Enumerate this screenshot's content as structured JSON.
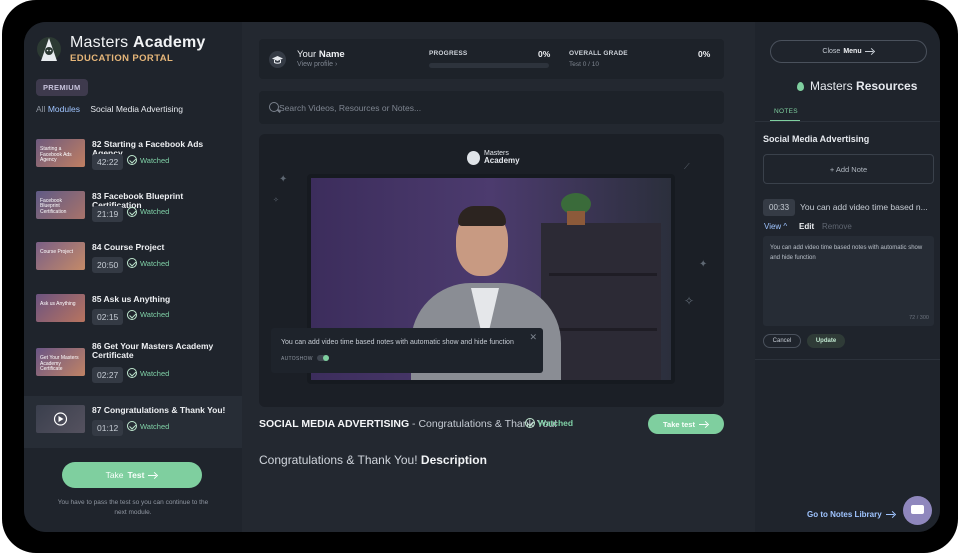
{
  "brand": {
    "title_light": "Masters",
    "title_bold": "Academy",
    "subtitle": "EDUCATION PORTAL",
    "badge": "PREMIUM"
  },
  "breadcrumb": {
    "all": "All",
    "modules": "Modules",
    "current": "Social Media Advertising"
  },
  "lessons": [
    {
      "thumb": "Starting a Facebook Ads Agency",
      "title": "82 Starting a Facebook Ads Agency",
      "duration": "42:22",
      "status": "Watched"
    },
    {
      "thumb": "Facebook Blueprint Certification",
      "title": "83 Facebook Blueprint Certification",
      "duration": "21:19",
      "status": "Watched"
    },
    {
      "thumb": "Course Project",
      "title": "84 Course Project",
      "duration": "20:50",
      "status": "Watched"
    },
    {
      "thumb": "Ask us Anything",
      "title": "85 Ask us Anything",
      "duration": "02:15",
      "status": "Watched"
    },
    {
      "thumb": "Get Your Masters Academy Certificate",
      "title": "86 Get Your Masters Academy Certificate",
      "duration": "02:27",
      "status": "Watched"
    },
    {
      "thumb": "",
      "title": "87 Congratulations & Thank You!",
      "duration": "01:12",
      "status": "Watched"
    }
  ],
  "left_footer": {
    "take_light": "Take",
    "take_bold": "Test",
    "note": "You have to pass the test so you can continue to the next module."
  },
  "profile": {
    "name_light": "Your",
    "name_bold": "Name",
    "view": "View profile",
    "progress_label": "PROGRESS",
    "progress_value": "0%",
    "progress_fraction": 0,
    "grade_label": "OVERALL GRADE",
    "grade_value": "0%",
    "grade_sub": "Test 0 / 10"
  },
  "search": {
    "placeholder": "Search Videos, Resources or Notes..."
  },
  "player": {
    "logo_top": "Masters",
    "logo_bottom": "Academy",
    "note_text": "You can add video time based notes with automatic show and hide function",
    "autoshow": "AUTOSHOW"
  },
  "video_info": {
    "module": "SOCIAL MEDIA ADVERTISING",
    "lesson": " - Congratulations & Thank You!",
    "status": "Watched",
    "take_test": "Take test"
  },
  "description": {
    "light": "Congratulations & Thank You!",
    "bold": "Description"
  },
  "resources": {
    "close_light": "Close",
    "close_bold": "Menu",
    "title_light": "Masters",
    "title_bold": "Resources",
    "tab": "NOTES",
    "subtitle": "Social Media Advertising",
    "add_note": "+ Add Note",
    "note_time": "00:33",
    "note_preview": "You can add video time based n...",
    "view": "View ^",
    "edit": "Edit",
    "remove": "Remove",
    "note_body": "You can add video time based notes with automatic show and hide function",
    "counter": "72 / 300",
    "cancel": "Cancel",
    "update": "Update",
    "library": "Go to Notes Library"
  },
  "colors": {
    "accent": "#7fcf9f",
    "link": "#9fc4ff",
    "gold": "#e6b679"
  }
}
